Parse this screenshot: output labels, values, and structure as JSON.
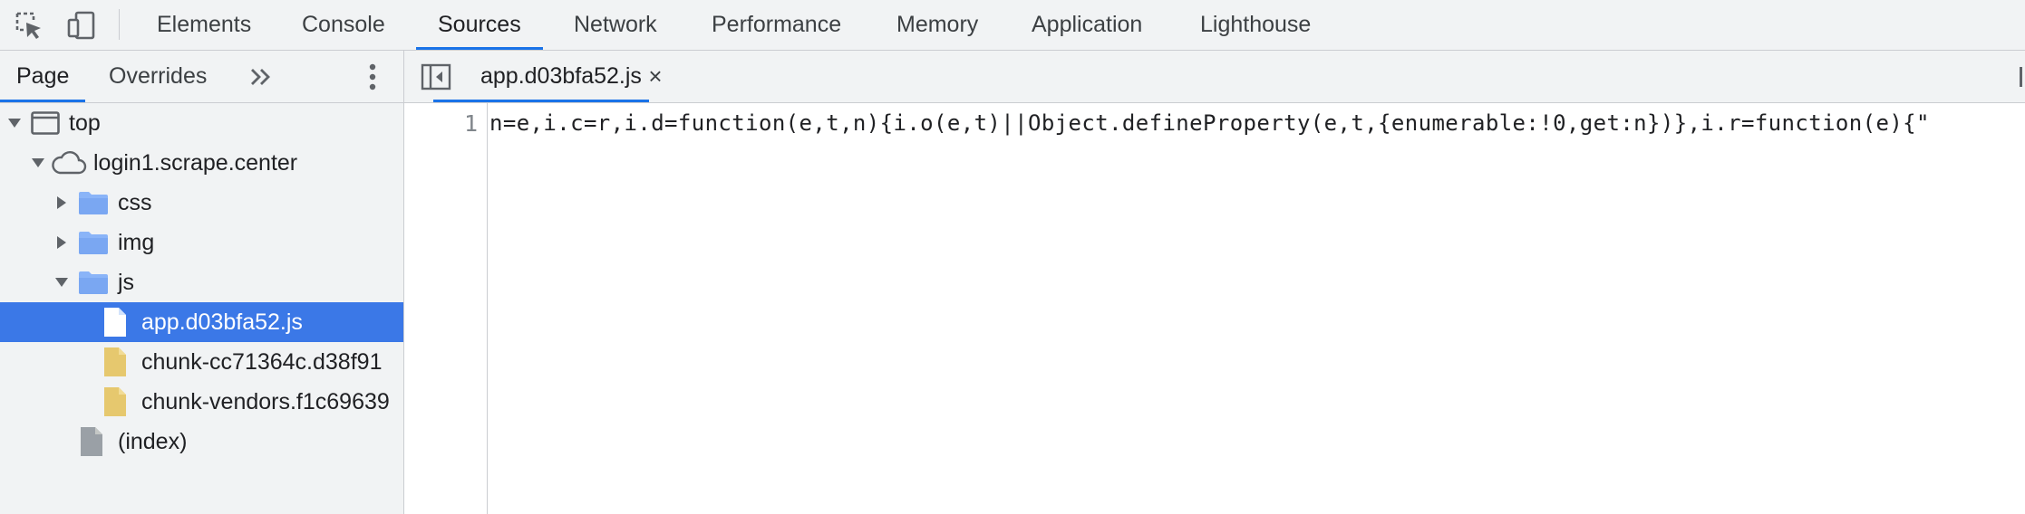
{
  "devtools": {
    "main_tabs": [
      {
        "label": "Elements"
      },
      {
        "label": "Console"
      },
      {
        "label": "Sources"
      },
      {
        "label": "Network"
      },
      {
        "label": "Performance"
      },
      {
        "label": "Memory"
      },
      {
        "label": "Application"
      },
      {
        "label": "Lighthouse"
      }
    ],
    "active_main_tab": "Sources",
    "toolbar_icons": [
      "inspect-element-icon",
      "device-toolbar-icon"
    ]
  },
  "navigator": {
    "tabs": [
      {
        "label": "Page"
      },
      {
        "label": "Overrides"
      }
    ],
    "active_tab": "Page",
    "more_tabs_icon": "double-chevron-right-icon",
    "menu_icon": "vertical-dots-icon",
    "tree": [
      {
        "label": "top",
        "icon": "frame-icon",
        "expanded": true
      },
      {
        "label": "login1.scrape.center",
        "icon": "cloud-icon",
        "expanded": true
      },
      {
        "label": "css",
        "icon": "folder-icon",
        "expanded": false
      },
      {
        "label": "img",
        "icon": "folder-icon",
        "expanded": false
      },
      {
        "label": "js",
        "icon": "folder-icon",
        "expanded": true
      },
      {
        "label": "app.d03bfa52.js",
        "icon": "file-icon",
        "selected": true
      },
      {
        "label": "chunk-cc71364c.d38f91",
        "icon": "script-file-icon"
      },
      {
        "label": "chunk-vendors.f1c69639",
        "icon": "script-file-icon"
      },
      {
        "label": "(index)",
        "icon": "document-icon"
      }
    ]
  },
  "editor": {
    "open_file": {
      "label": "app.d03bfa52.js",
      "close_icon": "×"
    },
    "line_number": "1",
    "code": "n=e,i.c=r,i.d=function(e,t,n){i.o(e,t)||Object.defineProperty(e,t,{enumerable:!0,get:n})},i.r=function(e){\"",
    "colors": {
      "accent": "#1a73e8",
      "selection": "#3b78e7",
      "folder": "#8ab4f8",
      "script_file": "#e6c86e",
      "document": "#9aa0a6"
    }
  }
}
